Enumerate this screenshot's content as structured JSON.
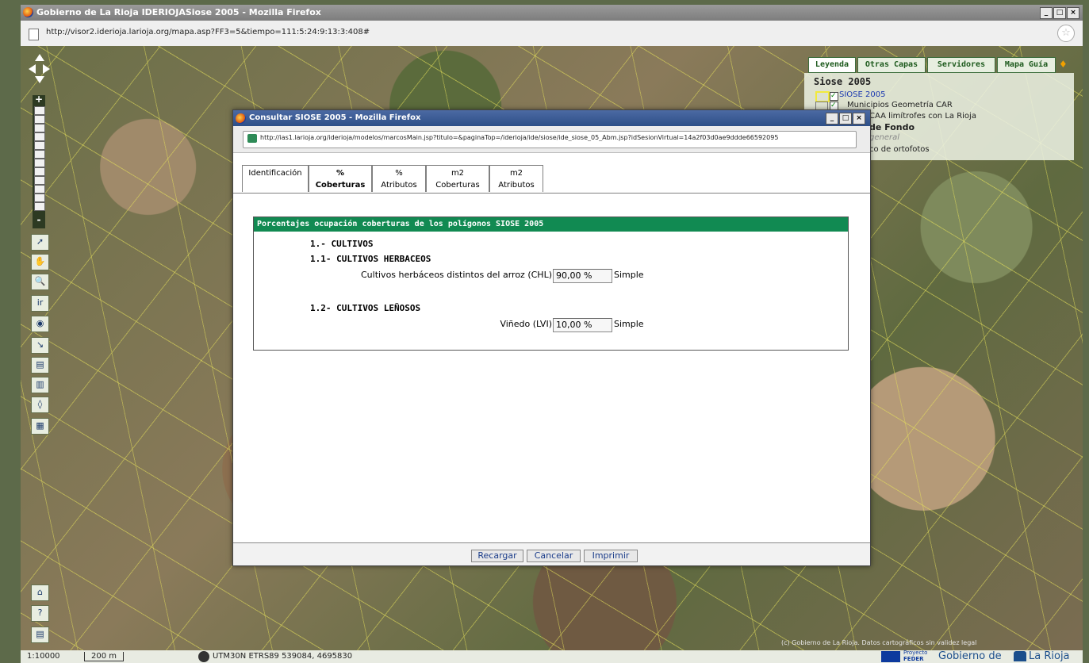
{
  "window": {
    "title": "Gobierno de La Rioja IDERIOJASiose 2005 - Mozilla Firefox",
    "url": "http://visor2.iderioja.larioja.org/mapa.asp?FF3=5&tiempo=111:5:24:9:13:3:408#",
    "min": "_",
    "max": "□",
    "close": "×"
  },
  "legend": {
    "tabs": [
      "Leyenda",
      "Otras Capas",
      "Servidores",
      "Mapa Guía"
    ],
    "section": "Siose 2005",
    "items": [
      "SIOSE 2005",
      "Municipios Geometría CAR",
      "CAA limítrofes con La Rioja"
    ],
    "fondo": "de Fondo",
    "general": "general",
    "ortofotos": "co de ortofotos"
  },
  "popup": {
    "title": "Consultar SIOSE 2005 - Mozilla Firefox",
    "url": "http://ias1.larioja.org/iderioja/modelos/marcosMain.jsp?titulo=&paginaTop=/iderioja/ide/siose/ide_siose_05_Abm.jsp?idSesionVirtual=14a2f03d0ae9ddde66592095",
    "tabs": [
      {
        "line1": "",
        "line2": "Identificación"
      },
      {
        "line1": "%",
        "line2": "Coberturas"
      },
      {
        "line1": "%",
        "line2": "Atributos"
      },
      {
        "line1": "m2",
        "line2": "Coberturas"
      },
      {
        "line1": "m2",
        "line2": "Atributos"
      }
    ],
    "panel_title": "Porcentajes ocupación coberturas de los polígonos SIOSE 2005",
    "sections": {
      "s1": "1.- CULTIVOS",
      "s11": "1.1- CULTIVOS HERBACEOS",
      "row1": {
        "label": "Cultivos herbáceos distintos del arroz (CHL)",
        "value": "90,00 %",
        "type": "Simple"
      },
      "s12": "1.2- CULTIVOS LEÑOSOS",
      "row2": {
        "label": "Viñedo (LVI)",
        "value": "10,00 %",
        "type": "Simple"
      }
    },
    "buttons": {
      "reload": "Recargar",
      "cancel": "Cancelar",
      "print": "Imprimir"
    }
  },
  "status": {
    "scale": "1:10000",
    "bar": "200 m",
    "coords": "UTM30N ETRS89 539084, 4695830",
    "credit": "(c) Gobierno de La Rioja. Datos cartográficos sin validez legal",
    "proyecto": "Proyecto",
    "feder": "FEDER",
    "gobierno": "Gobierno de",
    "rioja": "La Rioja"
  },
  "toolbar": {
    "zoom_in": "+",
    "zoom_out": "-"
  }
}
